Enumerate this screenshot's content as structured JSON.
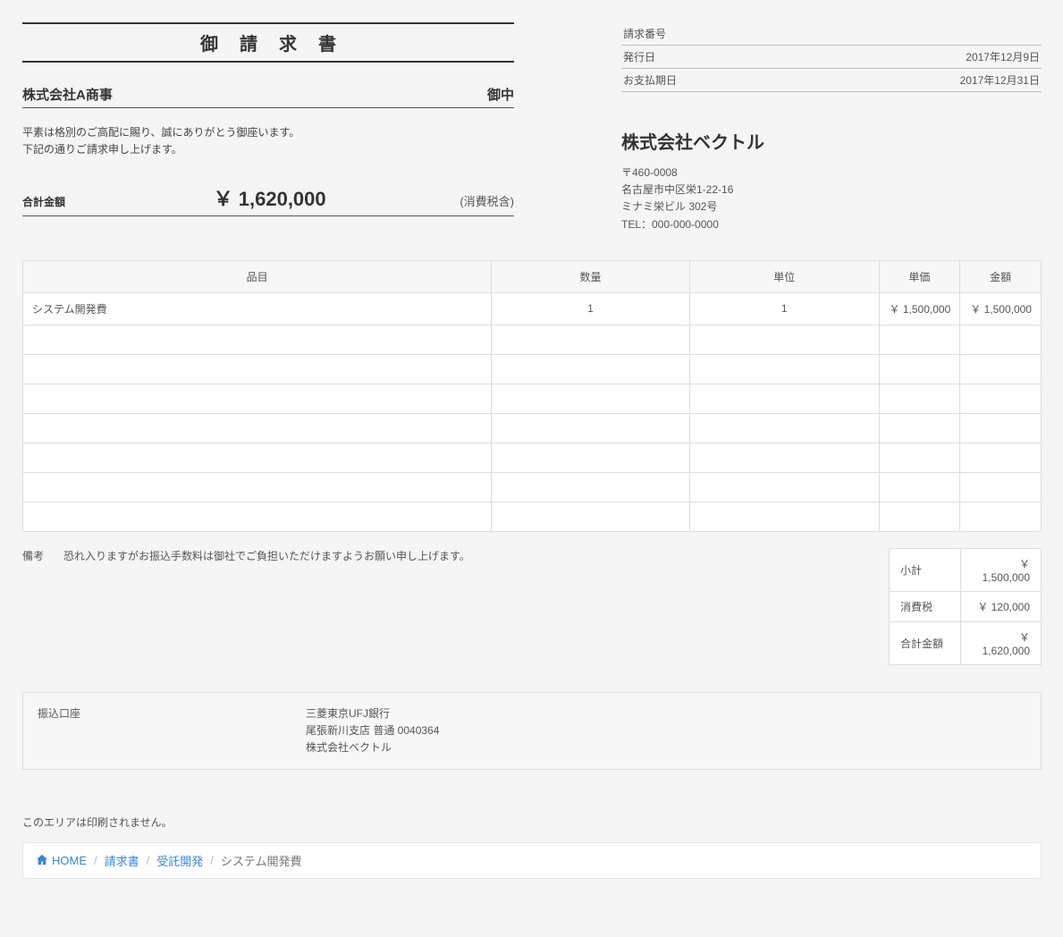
{
  "doc": {
    "title": "御請求書",
    "client_name": "株式会社A商事",
    "client_suffix": "御中",
    "greeting_line1": "平素は格別のご高配に賜り、誠にありがとう御座います。",
    "greeting_line2": "下記の通りご請求申し上げます。",
    "total_label": "合計金額",
    "total_amount": "￥ 1,620,000",
    "tax_note": "(消費税含)"
  },
  "meta": {
    "rows": [
      {
        "label": "請求番号",
        "value": ""
      },
      {
        "label": "発行日",
        "value": "2017年12月9日"
      },
      {
        "label": "お支払期日",
        "value": "2017年12月31日"
      }
    ]
  },
  "company": {
    "name": "株式会社ベクトル",
    "postal": "〒460-0008",
    "addr1": "名古屋市中区栄1-22-16",
    "addr2": "ミナミ栄ビル 302号",
    "tel": "TEL：000-000-0000"
  },
  "items": {
    "headers": {
      "item": "品目",
      "qty": "数量",
      "unit": "単位",
      "price": "単価",
      "amount": "金額"
    },
    "rows": [
      {
        "item": "システム開発費",
        "qty": "1",
        "unit": "1",
        "price": "￥ 1,500,000",
        "amount": "￥ 1,500,000"
      }
    ],
    "blank_rows": 7
  },
  "note": {
    "label": "備考",
    "text": "恐れ入りますがお振込手数料は御社でご負担いただけますようお願い申し上げます。"
  },
  "totals": {
    "rows": [
      {
        "label": "小計",
        "value": "￥ 1,500,000"
      },
      {
        "label": "消費税",
        "value": "￥ 120,000"
      },
      {
        "label": "合計金額",
        "value": "￥ 1,620,000"
      }
    ]
  },
  "bank": {
    "label": "振込口座",
    "line1": "三菱東京UFJ銀行",
    "line2": "尾張新川支店 普通 0040364",
    "line3": "株式会社ベクトル"
  },
  "noprint": {
    "label": "このエリアは印刷されません。",
    "breadcrumb": {
      "home": "HOME",
      "seg1": "請求書",
      "seg2": "受託開発",
      "current": "システム開発費"
    }
  }
}
